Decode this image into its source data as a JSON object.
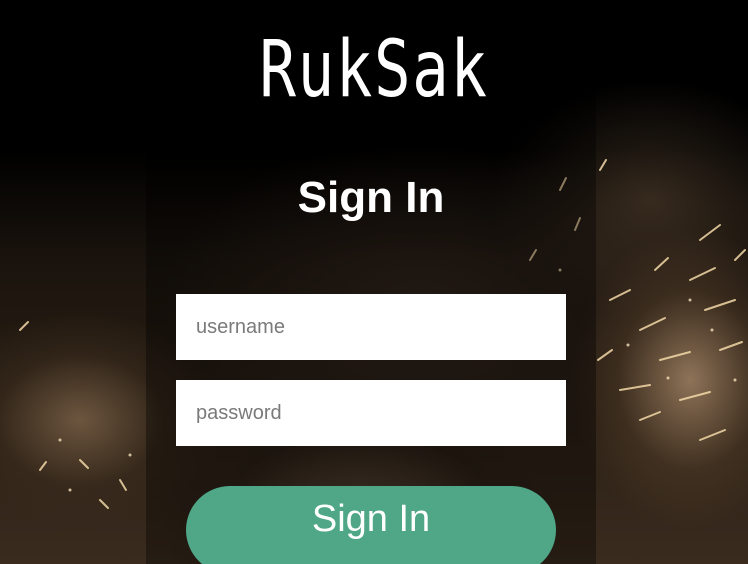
{
  "app": {
    "brand": "RukSak"
  },
  "form": {
    "heading": "Sign In",
    "username_placeholder": "username",
    "password_placeholder": "password",
    "submit_label": "Sign In"
  },
  "colors": {
    "background": "#000000",
    "button": "#4fa787",
    "field": "#ffffff",
    "text": "#ffffff"
  }
}
